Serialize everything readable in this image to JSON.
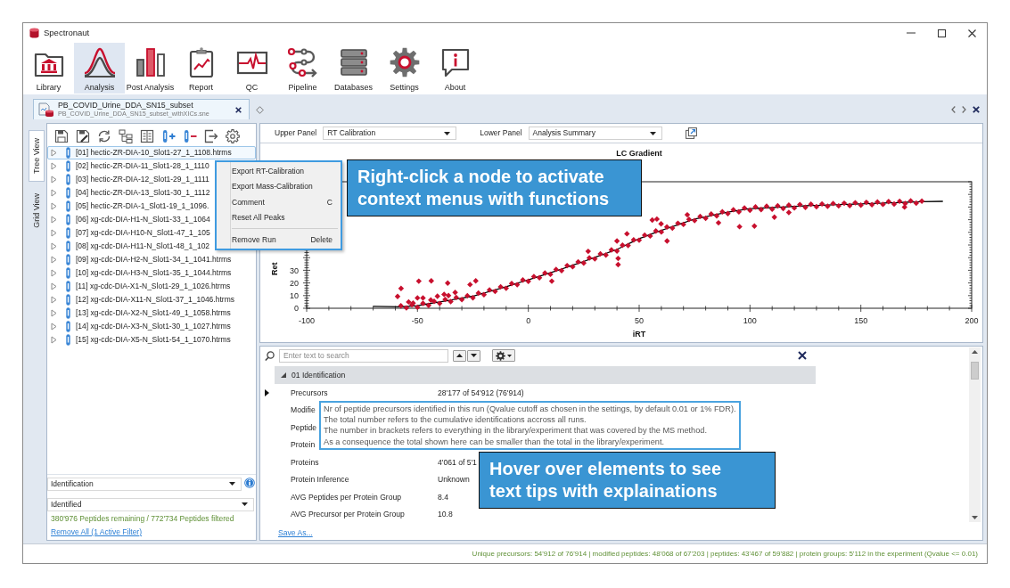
{
  "window": {
    "title": "Spectronaut"
  },
  "ribbon": [
    {
      "kind": "library",
      "label": "Library",
      "selected": false
    },
    {
      "kind": "analysis",
      "label": "Analysis",
      "selected": true
    },
    {
      "kind": "post_analysis",
      "label": "Post Analysis",
      "selected": false
    },
    {
      "kind": "report",
      "label": "Report",
      "selected": false
    },
    {
      "kind": "qc",
      "label": "QC",
      "selected": false
    },
    {
      "kind": "pipeline",
      "label": "Pipeline",
      "selected": false
    },
    {
      "kind": "databases",
      "label": "Databases",
      "selected": false
    },
    {
      "kind": "settings",
      "label": "Settings",
      "selected": false
    },
    {
      "kind": "about",
      "label": "About",
      "selected": false
    }
  ],
  "document_tab": {
    "title": "PB_COVID_Urine_DDA_SN15_subset",
    "subtitle": "PB_COVID_Urine_DDA_SN15_subset_withXICs.sne"
  },
  "side_tabs": [
    {
      "label": "Tree View",
      "selected": true
    },
    {
      "label": "Grid View",
      "selected": false
    }
  ],
  "runs": [
    {
      "label": "[01] hectic-ZR-DIA-10_Slot1-27_1_1108.htrms",
      "selected": true,
      "expanded": false
    },
    {
      "label": "[02] hectic-ZR-DIA-11_Slot1-28_1_1110",
      "selected": false,
      "expanded": false
    },
    {
      "label": "[03] hectic-ZR-DIA-12_Slot1-29_1_1111",
      "selected": false,
      "expanded": false
    },
    {
      "label": "[04] hectic-ZR-DIA-13_Slot1-30_1_1112",
      "selected": false,
      "expanded": false
    },
    {
      "label": "[05] hectic-ZR-DIA-1_Slot1-19_1_1096.",
      "selected": false,
      "expanded": false
    },
    {
      "label": "[06] xg-cdc-DIA-H1-N_Slot1-33_1_1064",
      "selected": false,
      "expanded": false
    },
    {
      "label": "[07] xg-cdc-DIA-H10-N_Slot1-47_1_105",
      "selected": false,
      "expanded": false
    },
    {
      "label": "[08] xg-cdc-DIA-H11-N_Slot1-48_1_102",
      "selected": false,
      "expanded": false
    },
    {
      "label": "[09] xg-cdc-DIA-H2-N_Slot1-34_1_1041.htrms",
      "selected": false,
      "expanded": false
    },
    {
      "label": "[10] xg-cdc-DIA-H3-N_Slot1-35_1_1044.htrms",
      "selected": false,
      "expanded": false
    },
    {
      "label": "[11] xg-cdc-DIA-X1-N_Slot1-29_1_1026.htrms",
      "selected": false,
      "expanded": false
    },
    {
      "label": "[12] xg-cdc-DIA-X11-N_Slot1-37_1_1046.htrms",
      "selected": false,
      "expanded": false
    },
    {
      "label": "[13] xg-cdc-DIA-X2-N_Slot1-49_1_1058.htrms",
      "selected": false,
      "expanded": false
    },
    {
      "label": "[14] xg-cdc-DIA-X3-N_Slot1-30_1_1027.htrms",
      "selected": false,
      "expanded": false
    },
    {
      "label": "[15] xg-cdc-DIA-X5-N_Slot1-54_1_1070.htrms",
      "selected": false,
      "expanded": false
    }
  ],
  "filters": {
    "category": "Identification",
    "value": "Identified",
    "summary": "380'976 Peptides remaining / 772'734 Peptides filtered",
    "link": "Remove All (1 Active Filter)"
  },
  "panel_selectors": [
    {
      "label": "Upper Panel",
      "value": "RT Calibration"
    },
    {
      "label": "Lower Panel",
      "value": "Analysis Summary"
    }
  ],
  "chart": {
    "chart_data": {
      "type": "scatter",
      "title": "LC Gradient",
      "xlabel": "iRT",
      "ylabel": "Ret",
      "xlim": [
        -100,
        200
      ],
      "ylim": [
        0,
        100
      ],
      "xticks": [
        {
          "value": -100,
          "label": "-100"
        },
        {
          "value": -50,
          "label": "-50"
        },
        {
          "value": 0,
          "label": "0"
        },
        {
          "value": 50,
          "label": "50"
        },
        {
          "value": 100,
          "label": "100"
        },
        {
          "value": 150,
          "label": "150"
        },
        {
          "value": 200,
          "label": "200"
        }
      ],
      "yticks": [
        {
          "value": 0,
          "label": "0"
        },
        {
          "value": 10,
          "label": "10"
        },
        {
          "value": 20,
          "label": "20"
        },
        {
          "value": 30,
          "label": "30"
        }
      ],
      "x": [
        -70,
        -57.5,
        -55,
        -52.5,
        -50,
        -47.5,
        -45,
        -42.5,
        -40,
        -37.5,
        -35,
        -32.5,
        -30,
        -27.5,
        -25,
        -22.5,
        -20,
        -17.5,
        -15,
        -12.5,
        -10,
        -7.5,
        -5,
        -2.5,
        0,
        2.5,
        5,
        7.5,
        10,
        12.5,
        15,
        17.5,
        20,
        22.5,
        25,
        27.5,
        30,
        32.5,
        35,
        37.5,
        40,
        42.5,
        45,
        47.5,
        50,
        52.5,
        55,
        57.5,
        60,
        62.5,
        65,
        67.5,
        70,
        72.5,
        75,
        77.5,
        80,
        82.5,
        85,
        87.5,
        90,
        92.5,
        95,
        97.5,
        100,
        102.5,
        105,
        107.5,
        110,
        112.5,
        115,
        117.5,
        120,
        122.5,
        125,
        127.5,
        130,
        132.5,
        135,
        137.5,
        140,
        142.5,
        145,
        147.5,
        150,
        152.5,
        155,
        157.5,
        160,
        162.5,
        165,
        167.5,
        170,
        172.5,
        175,
        177.5,
        187,
        -59,
        -57.4,
        -49.4,
        -43.8,
        -36.4,
        -50,
        -47.5,
        -26.3,
        -23.7,
        10.6,
        27,
        40,
        40.5,
        40.5,
        44.5,
        55.9,
        58,
        62.6,
        59.9,
        71.7,
        85.8,
        95.3,
        102,
        111,
        117.5,
        169.7,
        -38,
        -36,
        -41,
        -33,
        -44,
        -54,
        -52
      ],
      "series": [
        {
          "color": "#c8102e",
          "values": [
            null,
            2.0,
            0.3,
            2.8,
            0.8,
            3.9,
            2.3,
            5.4,
            3.8,
            7.0,
            5.3,
            8.5,
            6.8,
            9.9,
            8.3,
            12.0,
            10.8,
            14.5,
            13.3,
            17.0,
            15.8,
            19.6,
            18.6,
            22.3,
            21.3,
            25.1,
            24.1,
            27.8,
            26.8,
            30.7,
            29.8,
            33.7,
            32.8,
            36.7,
            35.8,
            39.8,
            39.0,
            43.0,
            42.1,
            46.1,
            45.3,
            49.8,
            49.6,
            54.1,
            53.8,
            57.8,
            57.1,
            61.1,
            60.3,
            64.2,
            63.3,
            67.2,
            66.3,
            70.2,
            69.3,
            72.6,
            71.1,
            74.5,
            73.0,
            76.3,
            74.8,
            77.9,
            76.2,
            79.2,
            77.5,
            80.1,
            78.0,
            80.6,
            78.4,
            81.0,
            78.9,
            81.5,
            79.3,
            82.0,
            79.8,
            82.2,
            80.3,
            82.5,
            80.6,
            82.8,
            80.9,
            83.0,
            81.2,
            83.4,
            81.5,
            83.7,
            81.8,
            84.0,
            82.1,
            84.3,
            82.4,
            84.6,
            82.8,
            84.9,
            83.1,
            84.7,
            null,
            9.4,
            15.7,
            21.4,
            21.7,
            19.9,
            8.2,
            8.2,
            18.7,
            21.7,
            21.4,
            45,
            53.2,
            39.4,
            34.5,
            58.9,
            69.7,
            70.5,
            53.2,
            66.7,
            73.9,
            67.5,
            64.5,
            64.9,
            72,
            75.7,
            80,
            11,
            10,
            9.5,
            12.5,
            6.5,
            5,
            4
          ]
        },
        {
          "type": "line",
          "color": "#000000",
          "values": [
            1.5,
            1.2,
            1.4,
            1.7,
            2,
            2.8,
            3.5,
            4.3,
            5,
            5.8,
            6.5,
            7.3,
            8,
            8.8,
            9.5,
            10.8,
            12,
            13.3,
            14.5,
            15.8,
            17,
            18.4,
            19.8,
            21.1,
            22.5,
            23.9,
            25.3,
            26.6,
            28,
            29.5,
            31,
            32.5,
            34,
            35.5,
            37,
            38.6,
            40.2,
            41.8,
            43.3,
            44.9,
            46.5,
            48.6,
            50.8,
            52.9,
            55,
            56.6,
            58.3,
            59.9,
            61.5,
            63,
            64.5,
            66,
            67.5,
            69,
            70.5,
            71.4,
            72.3,
            73.3,
            74.2,
            75.1,
            76,
            76.7,
            77.4,
            78,
            78.7,
            78.9,
            79.2,
            79.4,
            79.6,
            79.8,
            80.1,
            80.3,
            80.5,
            80.8,
            81,
            81.2,
            81.3,
            81.5,
            81.6,
            81.8,
            81.9,
            82.1,
            82.2,
            82.4,
            82.5,
            82.7,
            82.8,
            83,
            83.1,
            83.3,
            83.4,
            83.6,
            83.8,
            83.9,
            84.1,
            84.2,
            84.5,
            null,
            null,
            null,
            null,
            null,
            null,
            null,
            null,
            null,
            null,
            null,
            null,
            null,
            null,
            null,
            null,
            null,
            null,
            null,
            null,
            null,
            null,
            null,
            null,
            null,
            null,
            null,
            null,
            null,
            null,
            null,
            null,
            null
          ]
        }
      ]
    }
  },
  "summary": {
    "search": {
      "placeholder": "Enter text to search"
    },
    "groups": [
      {
        "label": "01 Identification",
        "expanded": true,
        "rows": [
          {
            "label": "Precursors",
            "value": "28'177 of 54'912 (76'914)",
            "selected": true
          },
          {
            "label": "Modifie",
            "selected": false
          },
          {
            "label": "Peptide",
            "selected": false
          },
          {
            "label": "Protein",
            "selected": false
          },
          {
            "label": "Proteins",
            "value": "4'061 of 5'1",
            "selected": false
          },
          {
            "label": "Protein Inference",
            "value": "Unknown",
            "selected": false
          },
          {
            "label": "AVG Peptides per Protein Group",
            "value": "8.4",
            "selected": false
          },
          {
            "label": "AVG Precursor per Protein Group",
            "value": "10.8",
            "selected": false
          }
        ]
      }
    ],
    "link": "Save As..."
  },
  "context_menu": [
    {
      "kind": "item",
      "label": "Export RT-Calibration"
    },
    {
      "kind": "item",
      "label": "Export Mass-Calibration"
    },
    {
      "kind": "item",
      "label": "Comment",
      "shortcut": "C"
    },
    {
      "kind": "item",
      "label": "Reset All Peaks"
    },
    {
      "kind": "separator"
    },
    {
      "kind": "item",
      "label": "Remove Run",
      "shortcut": "Delete"
    }
  ],
  "tooltip": {
    "lines": [
      "Nr of peptide precursors identified in this run (Qvalue cutoff as chosen in the settings, by default 0.01 or 1% FDR).",
      "The total number refers to the cumulative identifications accross all runs.",
      "The number in brackets refers to everything in the library/experiment that was covered by the MS method.",
      "As a consequence the total shown here can be smaller than the total in the library/experiment."
    ]
  },
  "callouts": [
    {
      "lines": [
        "Right-click a node to activate",
        "context menus with functions"
      ]
    },
    {
      "lines": [
        "Hover over elements to see",
        "text tips with explainations"
      ]
    }
  ],
  "status_bar": {
    "text": "Unique precursors: 54'912 of 76'914 | modified peptides: 48'068 of 67'203 | peptides: 43'467 of 59'882 | protein groups: 5'112 in the experiment (Qvalue <= 0.01)"
  }
}
